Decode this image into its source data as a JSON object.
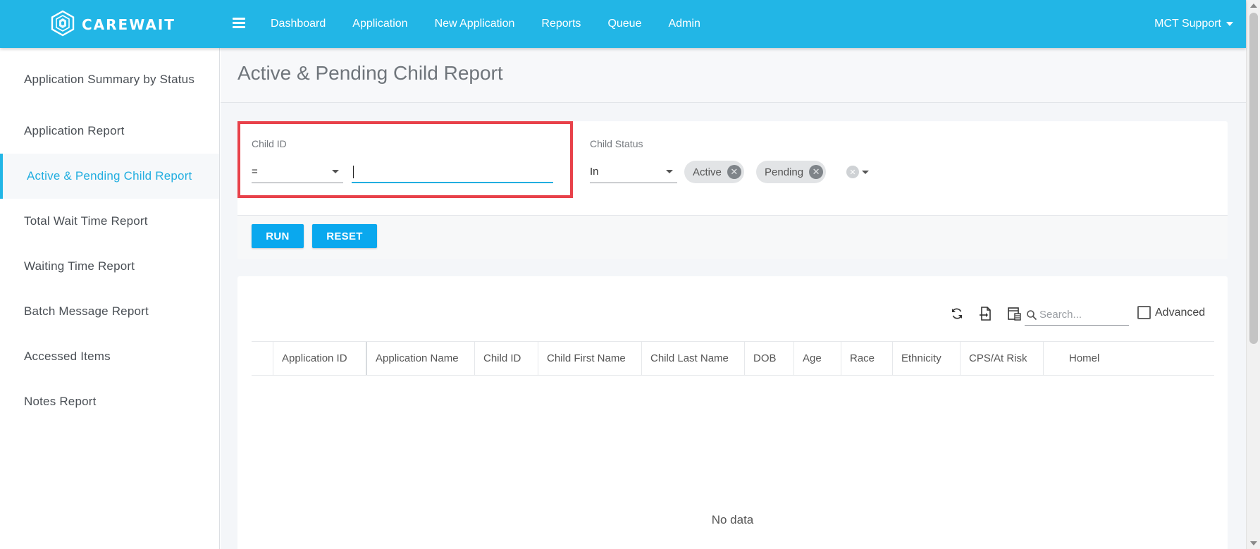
{
  "app": {
    "brand_name": "CAREWAIT",
    "logo_icon": "carewait-cube-logo",
    "accent_color": "#22b6e6",
    "highlight_color": "#e8414a"
  },
  "nav": {
    "menu_icon": "hamburger-menu-icon",
    "items": [
      "Dashboard",
      "Application",
      "New Application",
      "Reports",
      "Queue",
      "Admin"
    ],
    "user_label": "MCT Support"
  },
  "sidebar": {
    "items": [
      "Application Summary by Status",
      "Application Report",
      "Active & Pending Child Report",
      "Total Wait Time Report",
      "Waiting Time Report",
      "Batch Message Report",
      "Accessed Items",
      "Notes Report"
    ],
    "active_index": 2
  },
  "page": {
    "title": "Active & Pending Child Report"
  },
  "filters": {
    "child_id": {
      "label": "Child ID",
      "operator": "=",
      "value": ""
    },
    "child_status": {
      "label": "Child Status",
      "operator": "In",
      "chips": [
        "Active",
        "Pending"
      ]
    }
  },
  "actions": {
    "run_label": "RUN",
    "reset_label": "RESET"
  },
  "table": {
    "toolbar_icons": [
      "refresh-icon",
      "export-icon",
      "column-chooser-icon",
      "search-icon"
    ],
    "search_placeholder": "Search...",
    "advanced_label": "Advanced",
    "advanced_checked": false,
    "columns": [
      "Application ID",
      "Application Name",
      "Child ID",
      "Child First Name",
      "Child Last Name",
      "DOB",
      "Age",
      "Race",
      "Ethnicity",
      "CPS/At Risk",
      "Homel"
    ],
    "rows": [],
    "empty_text": "No data"
  }
}
